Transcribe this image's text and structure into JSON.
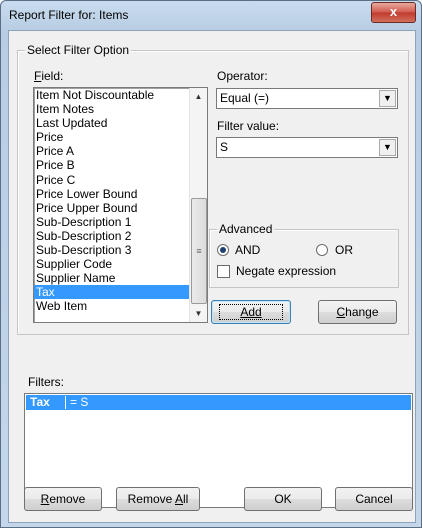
{
  "window": {
    "title": "Report Filter for: Items",
    "close_label": "x"
  },
  "select_group": {
    "title": "Select Filter Option"
  },
  "field": {
    "label": "Field:",
    "items": [
      "Item Not Discountable",
      "Item Notes",
      "Last Updated",
      "Price",
      "Price A",
      "Price B",
      "Price C",
      "Price Lower Bound",
      "Price Upper Bound",
      "Sub-Description 1",
      "Sub-Description 2",
      "Sub-Description 3",
      "Supplier Code",
      "Supplier Name",
      "Tax",
      "Web Item"
    ],
    "selected": "Tax"
  },
  "operator": {
    "label": "Operator:",
    "value": "Equal (=)"
  },
  "filter_value": {
    "label": "Filter value:",
    "value": "S"
  },
  "advanced": {
    "title": "Advanced",
    "and_label": "AND",
    "or_label": "OR",
    "selected": "AND",
    "negate_label": "Negate expression",
    "negate_checked": false
  },
  "buttons": {
    "add": "Add",
    "change": "Change",
    "remove": "Remove",
    "remove_all": "Remove All",
    "ok": "OK",
    "cancel": "Cancel"
  },
  "filters": {
    "label": "Filters:",
    "rows": [
      {
        "field": "Tax",
        "expression": "= S"
      }
    ]
  }
}
